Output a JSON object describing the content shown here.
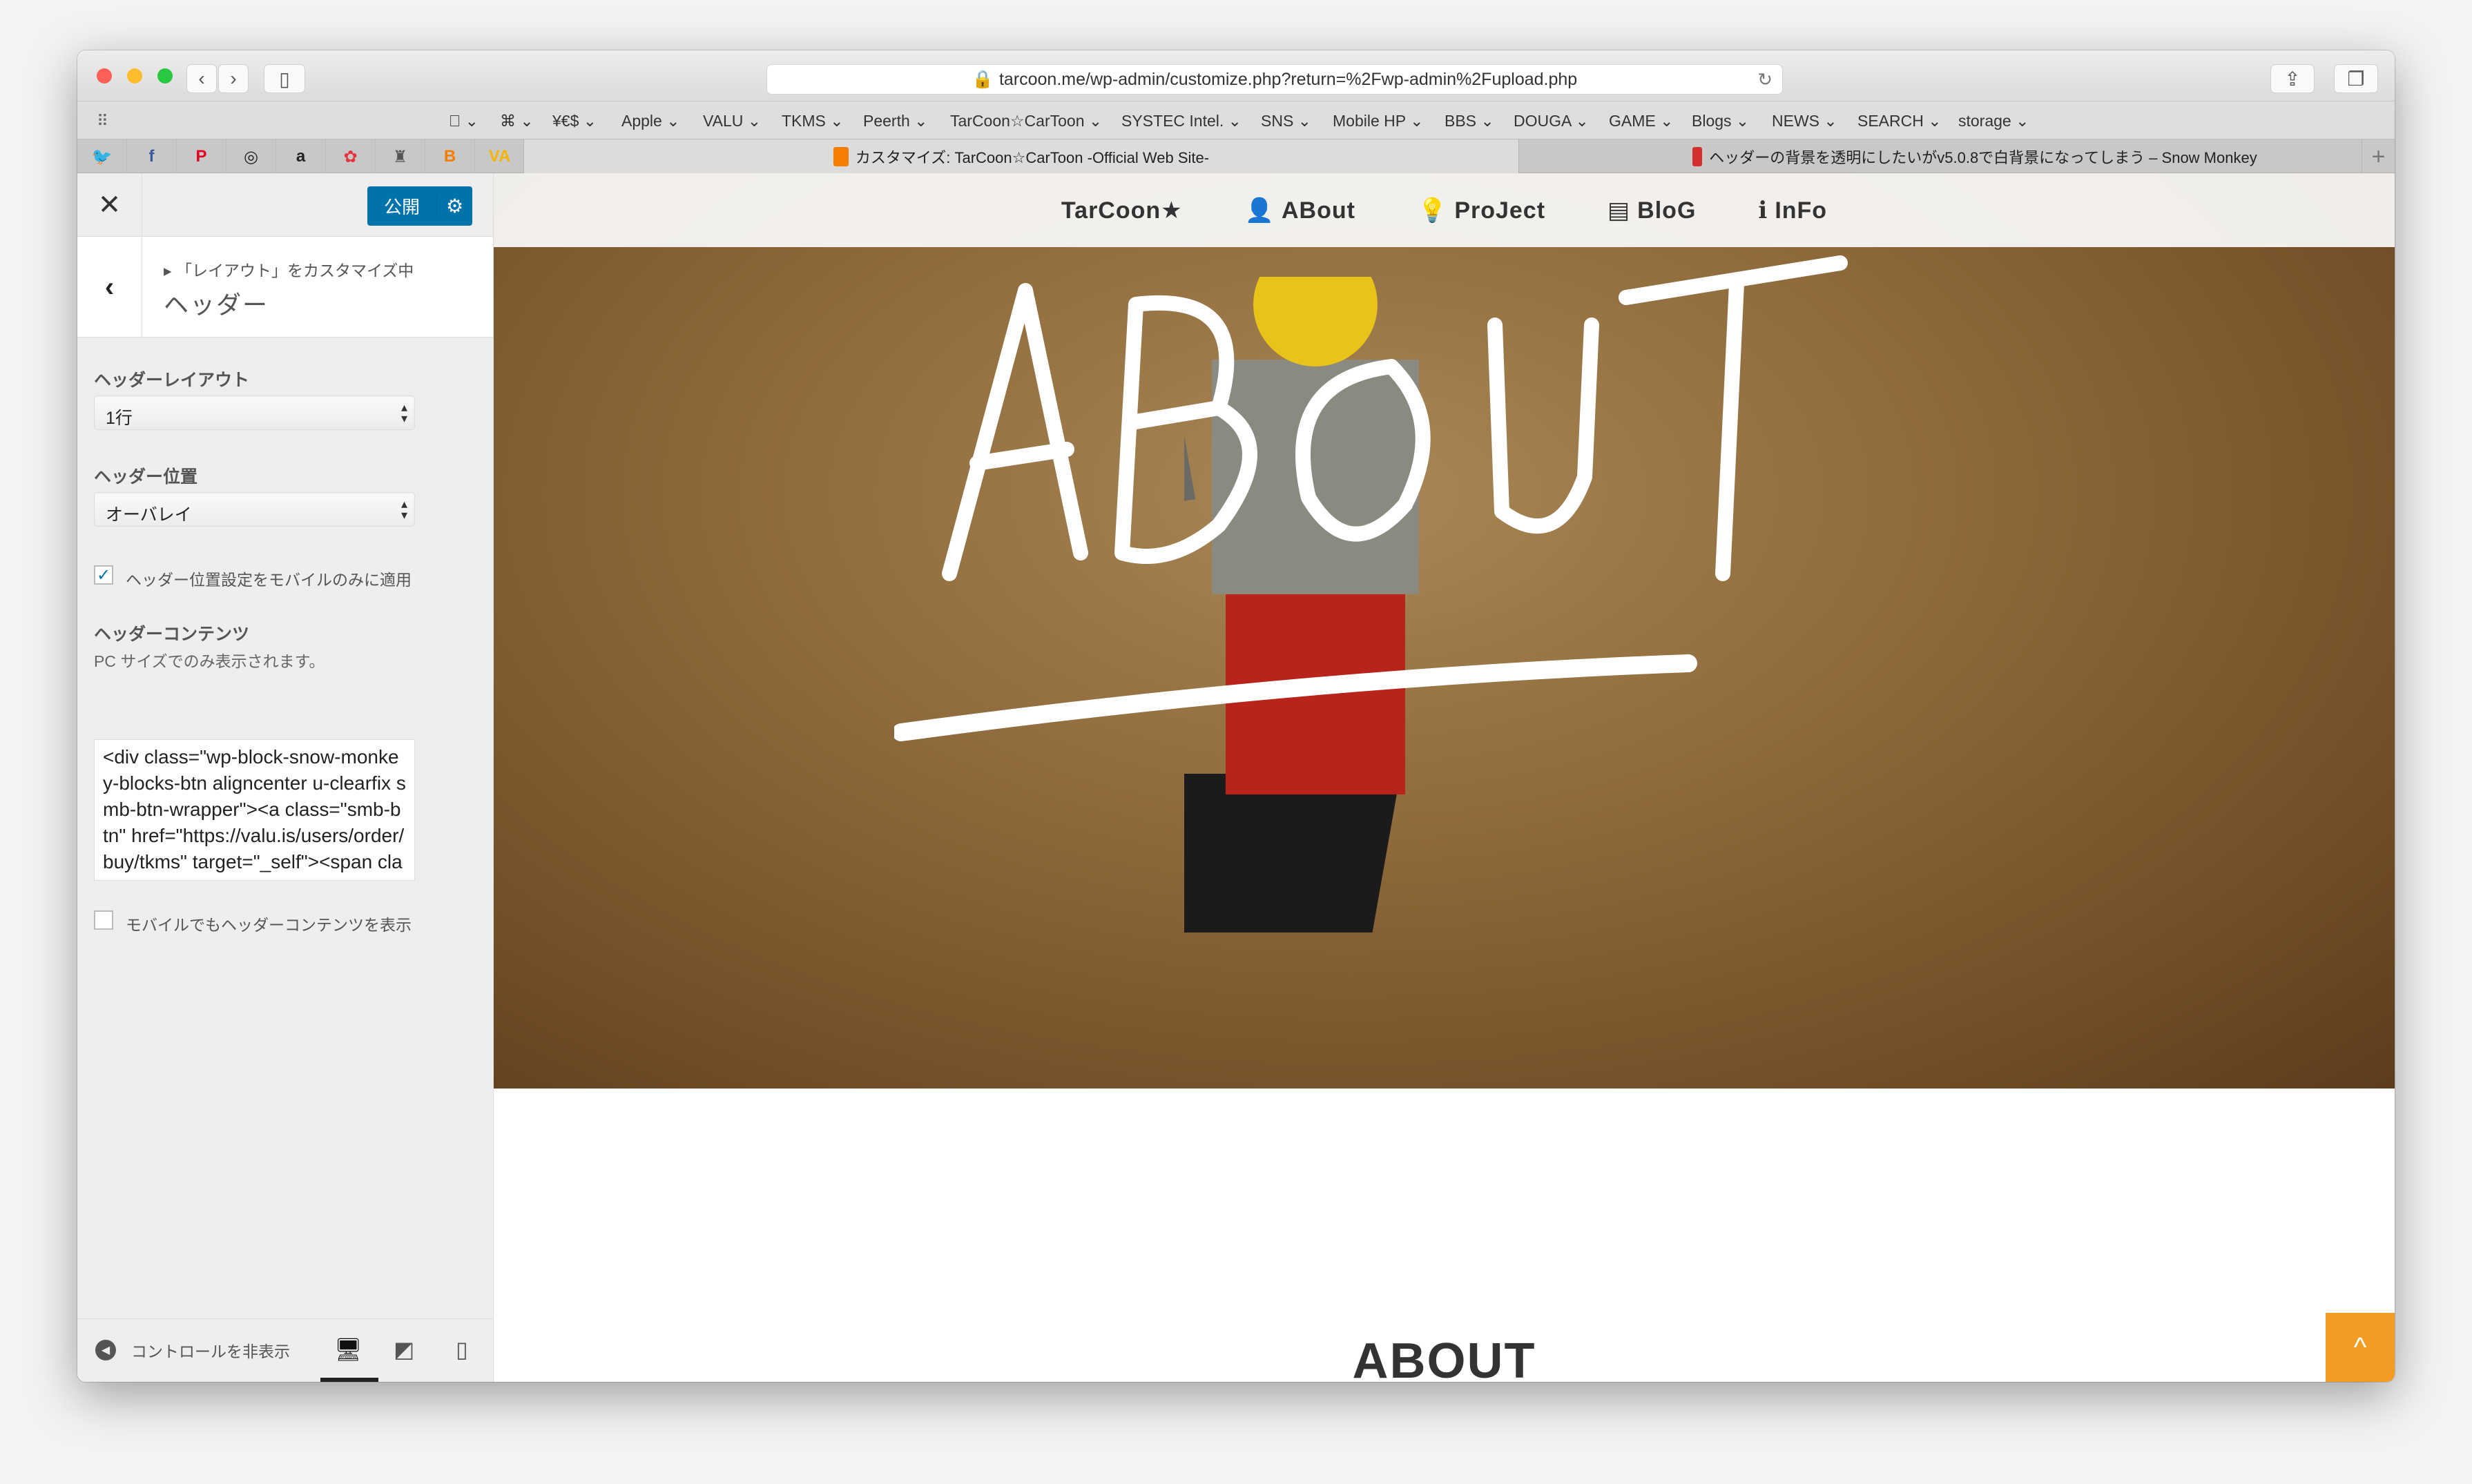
{
  "browser": {
    "url": "tarcoon.me/wp-admin/customize.php?return=%2Fwp-admin%2Fupload.php",
    "bookmarks": [
      "",
      "⌘",
      "¥€$",
      "Apple",
      "VALU",
      "TKMS",
      "Peerth",
      "TarCoon☆CarToon",
      "SYSTEC Intel.",
      "SNS",
      "Mobile HP",
      "BBS",
      "DOUGA",
      "GAME",
      "Blogs",
      "NEWS",
      "SEARCH",
      "storage"
    ],
    "favorites": [
      {
        "icon": "twitter-icon",
        "glyph": "🐦",
        "color": "#1da1f2"
      },
      {
        "icon": "facebook-icon",
        "glyph": "f",
        "color": "#3b5998"
      },
      {
        "icon": "pinterest-icon",
        "glyph": "P",
        "color": "#e60023"
      },
      {
        "icon": "instagram-icon",
        "glyph": "◎",
        "color": "#222222"
      },
      {
        "icon": "amazon-icon",
        "glyph": "a",
        "color": "#222222"
      },
      {
        "icon": "flower-icon",
        "glyph": "✿",
        "color": "#e8323c"
      },
      {
        "icon": "figure-icon",
        "glyph": "♜",
        "color": "#555555"
      },
      {
        "icon": "blogger-icon",
        "glyph": "B",
        "color": "#f57d00"
      },
      {
        "icon": "valu-icon",
        "glyph": "VA",
        "color": "#f5b400"
      }
    ],
    "tabs": [
      {
        "title": "カスタマイズ: TarCoon☆CarToon -Official Web Site-",
        "active": true,
        "color": "#f57d00"
      },
      {
        "title": "ヘッダーの背景を透明にしたいがv5.0.8で白背景になってしまう – Snow Monkey",
        "active": false,
        "color": "#d32f2f"
      }
    ]
  },
  "sidebar": {
    "publish_label": "公開",
    "breadcrumb": "「レイアウト」をカスタマイズ中",
    "section_title": "ヘッダー",
    "layout_label": "ヘッダーレイアウト",
    "layout_value": "1行",
    "position_label": "ヘッダー位置",
    "position_value": "オーバレイ",
    "mobile_only_label": "ヘッダー位置設定をモバイルのみに適用",
    "mobile_only_checked": true,
    "content_label": "ヘッダーコンテンツ",
    "content_desc": "PC サイズでのみ表示されます。",
    "content_value": "<div class=\"wp-block-snow-monkey-blocks-btn aligncenter u-clearfix smb-btn-wrapper\"><a class=\"smb-btn\" href=\"https://valu.is/users/order/buy/tkms\" target=\"_self\"><span class=\"smb-",
    "show_mobile_label": "モバイルでもヘッダーコンテンツを表示",
    "show_mobile_checked": false,
    "hide_controls_label": "コントロールを非表示",
    "active_device": "desktop"
  },
  "site": {
    "nav": [
      {
        "label": "TarCoon★",
        "icon": ""
      },
      {
        "label": "ABout",
        "icon": "user-icon"
      },
      {
        "label": "ProJect",
        "icon": "lightbulb-icon"
      },
      {
        "label": "BloG",
        "icon": "newspaper-icon"
      },
      {
        "label": "InFo",
        "icon": "info-icon"
      }
    ],
    "hero_lettering": "ABOUT",
    "heading": "ABOUT",
    "accent": "#f39c24"
  }
}
